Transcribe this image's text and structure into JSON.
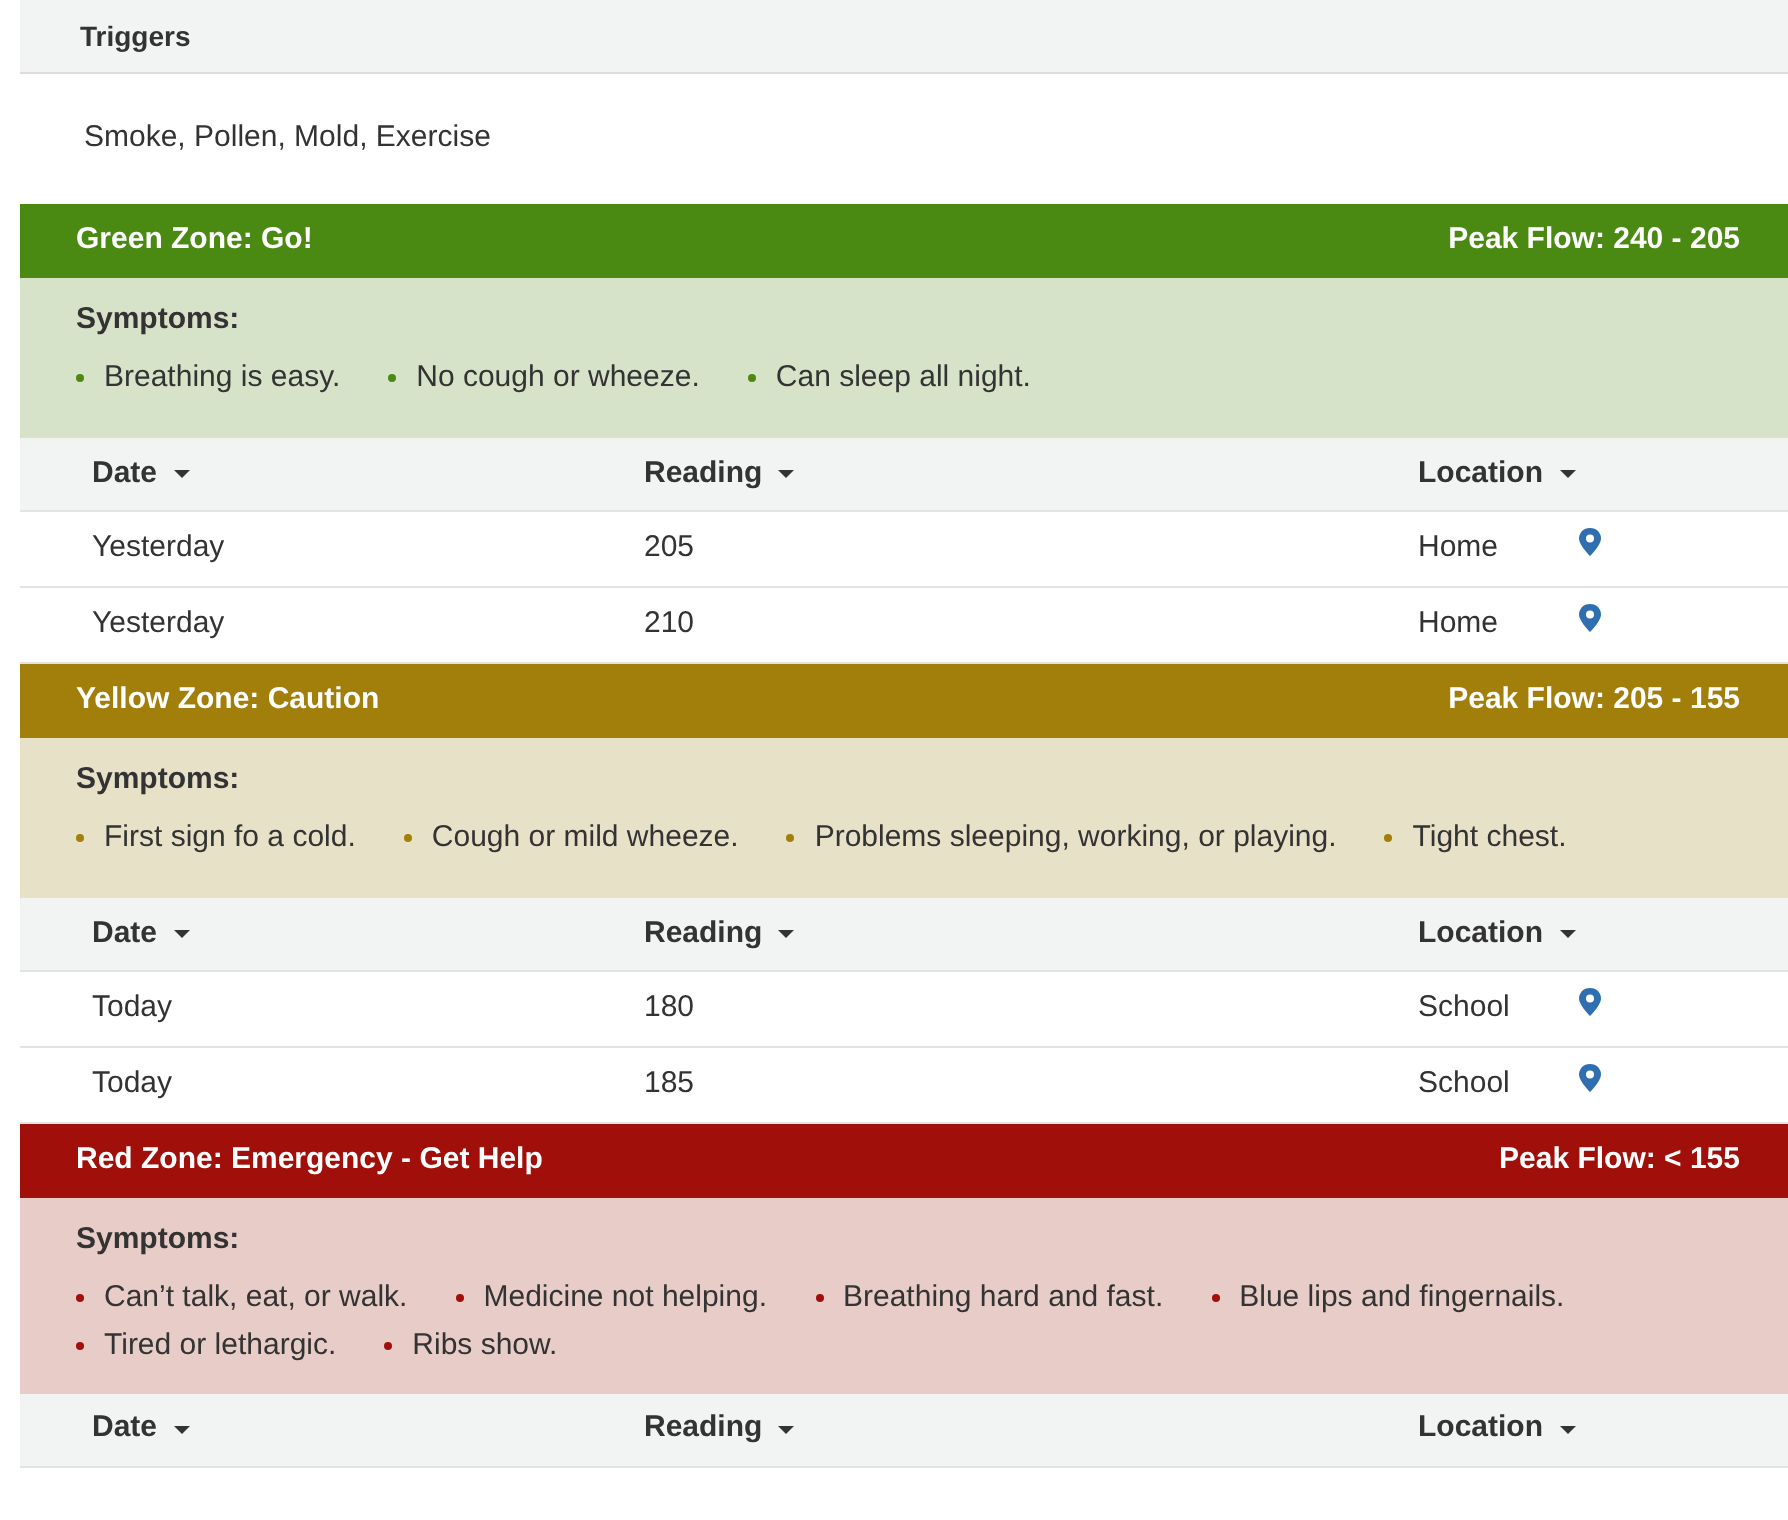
{
  "triggers": {
    "title": "Triggers",
    "text": "Smoke, Pollen, Mold, Exercise"
  },
  "zones": [
    {
      "title": "Green Zone: Go!",
      "peak_flow": "Peak Flow: 240 - 205",
      "color": "#4a8a12",
      "symptoms_label": "Symptoms:",
      "symptoms": [
        "Breathing is easy.",
        "No cough or wheeze.",
        "Can sleep all night."
      ],
      "columns": [
        "Date",
        "Reading",
        "Location"
      ],
      "rows": [
        {
          "date": "Yesterday",
          "reading": "205",
          "location": "Home"
        },
        {
          "date": "Yesterday",
          "reading": "210",
          "location": "Home"
        }
      ]
    },
    {
      "title": "Yellow Zone: Caution",
      "peak_flow": "Peak Flow: 205 - 155",
      "color": "#a17f0a",
      "symptoms_label": "Symptoms:",
      "symptoms": [
        "First sign fo a cold.",
        "Cough or mild wheeze.",
        "Problems sleeping, working, or playing.",
        "Tight chest."
      ],
      "columns": [
        "Date",
        "Reading",
        "Location"
      ],
      "rows": [
        {
          "date": "Today",
          "reading": "180",
          "location": "School"
        },
        {
          "date": "Today",
          "reading": "185",
          "location": "School"
        }
      ]
    },
    {
      "title": "Red Zone: Emergency - Get Help",
      "peak_flow": "Peak Flow: < 155",
      "color": "#a00f0a",
      "symptoms_label": "Symptoms:",
      "symptoms": [
        "Can’t talk, eat, or walk.",
        "Medicine not helping.",
        "Breathing hard and fast.",
        "Blue lips and fingernails.",
        "Tired or lethargic.",
        "Ribs show."
      ],
      "columns": [
        "Date",
        "Reading",
        "Location"
      ]
    }
  ]
}
